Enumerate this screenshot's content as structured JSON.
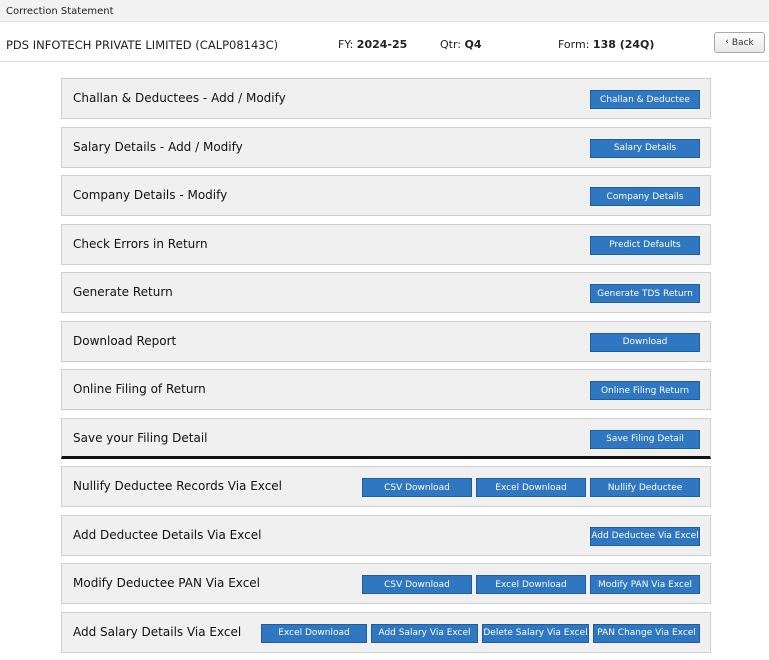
{
  "window": {
    "title": "Correction Statement"
  },
  "header": {
    "company": "PDS INFOTECH PRIVATE LIMITED (CALP08143C)",
    "fy_label": "FY:",
    "fy_value": "2024-25",
    "qtr_label": "Qtr:",
    "qtr_value": "Q4",
    "form_label": "Form:",
    "form_value": "138 (24Q)",
    "back_label": "Back",
    "back_icon": "chevron-left-icon"
  },
  "rows": [
    {
      "label": "Challan & Deductees - Add / Modify",
      "buttons": [
        "Challan & Deductee"
      ]
    },
    {
      "label": "Salary Details - Add / Modify",
      "buttons": [
        "Salary Details"
      ]
    },
    {
      "label": "Company Details - Modify",
      "buttons": [
        "Company Details"
      ]
    },
    {
      "label": "Check Errors in Return",
      "buttons": [
        "Predict Defaults"
      ]
    },
    {
      "label": "Generate Return",
      "buttons": [
        "Generate TDS Return"
      ]
    },
    {
      "label": "Download Report",
      "buttons": [
        "Download"
      ]
    },
    {
      "label": "Online Filing of Return",
      "buttons": [
        "Online Filing Return"
      ]
    },
    {
      "label": "Save your Filing Detail",
      "buttons": [
        "Save Filing Detail"
      ]
    },
    {
      "label": "Nullify Deductee Records Via Excel",
      "buttons": [
        "CSV Download",
        "Excel Download",
        "Nullify Deductee"
      ]
    },
    {
      "label": "Add Deductee Details Via Excel",
      "buttons": [
        "Add Deductee Via Excel"
      ]
    },
    {
      "label": "Modify Deductee PAN Via Excel",
      "buttons": [
        "CSV Download",
        "Excel Download",
        "Modify PAN Via Excel"
      ]
    },
    {
      "label": "Add Salary Details Via Excel",
      "buttons": [
        "Excel Download",
        "Add Salary Via Excel",
        "Delete Salary Via Excel",
        "PAN Change Via Excel"
      ]
    }
  ],
  "colors": {
    "button_bg": "#2f77c0",
    "row_bg": "#f0f0f0"
  }
}
